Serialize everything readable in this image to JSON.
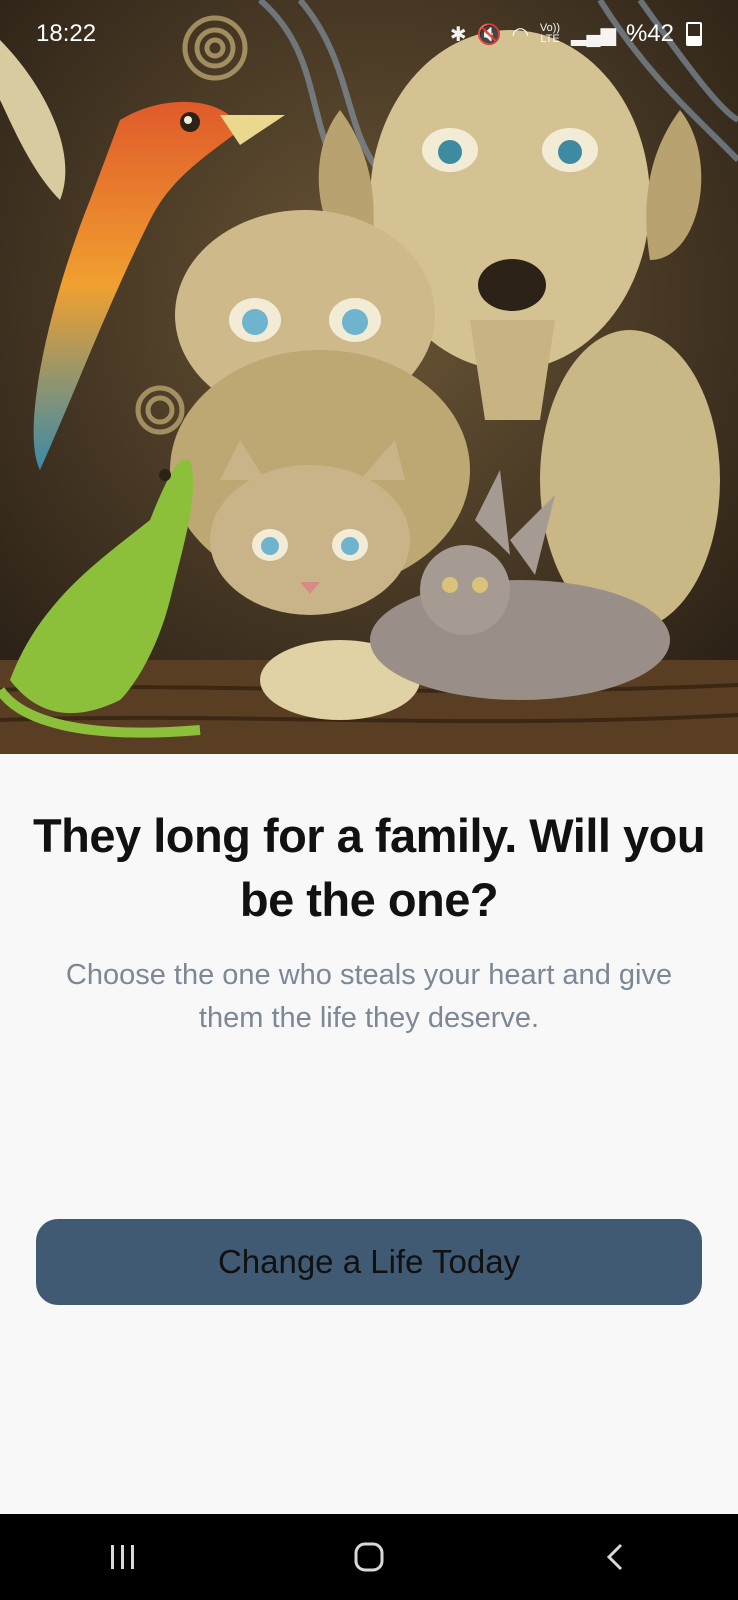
{
  "status_bar": {
    "time": "18:22",
    "battery_text": "%42",
    "volte_label": "Vo)) LTE",
    "icons": [
      "bluetooth-icon",
      "mute-icon",
      "wifi-icon",
      "volte-icon",
      "signal-icon",
      "battery-icon"
    ]
  },
  "hero": {
    "icon": "sad-animals-painting"
  },
  "main": {
    "headline": "They long for a family. Will you be the one?",
    "subtext": "Choose the one who steals your heart and give them the life they deserve.",
    "cta_label": "Change a Life Today"
  },
  "colors": {
    "cta_background": "#3f5a72",
    "subtext": "#7d8896",
    "page_background": "#f8f8f9",
    "nav_background": "#000000"
  },
  "nav_bar": {
    "items": [
      "recent-apps-icon",
      "home-icon",
      "back-icon"
    ]
  }
}
